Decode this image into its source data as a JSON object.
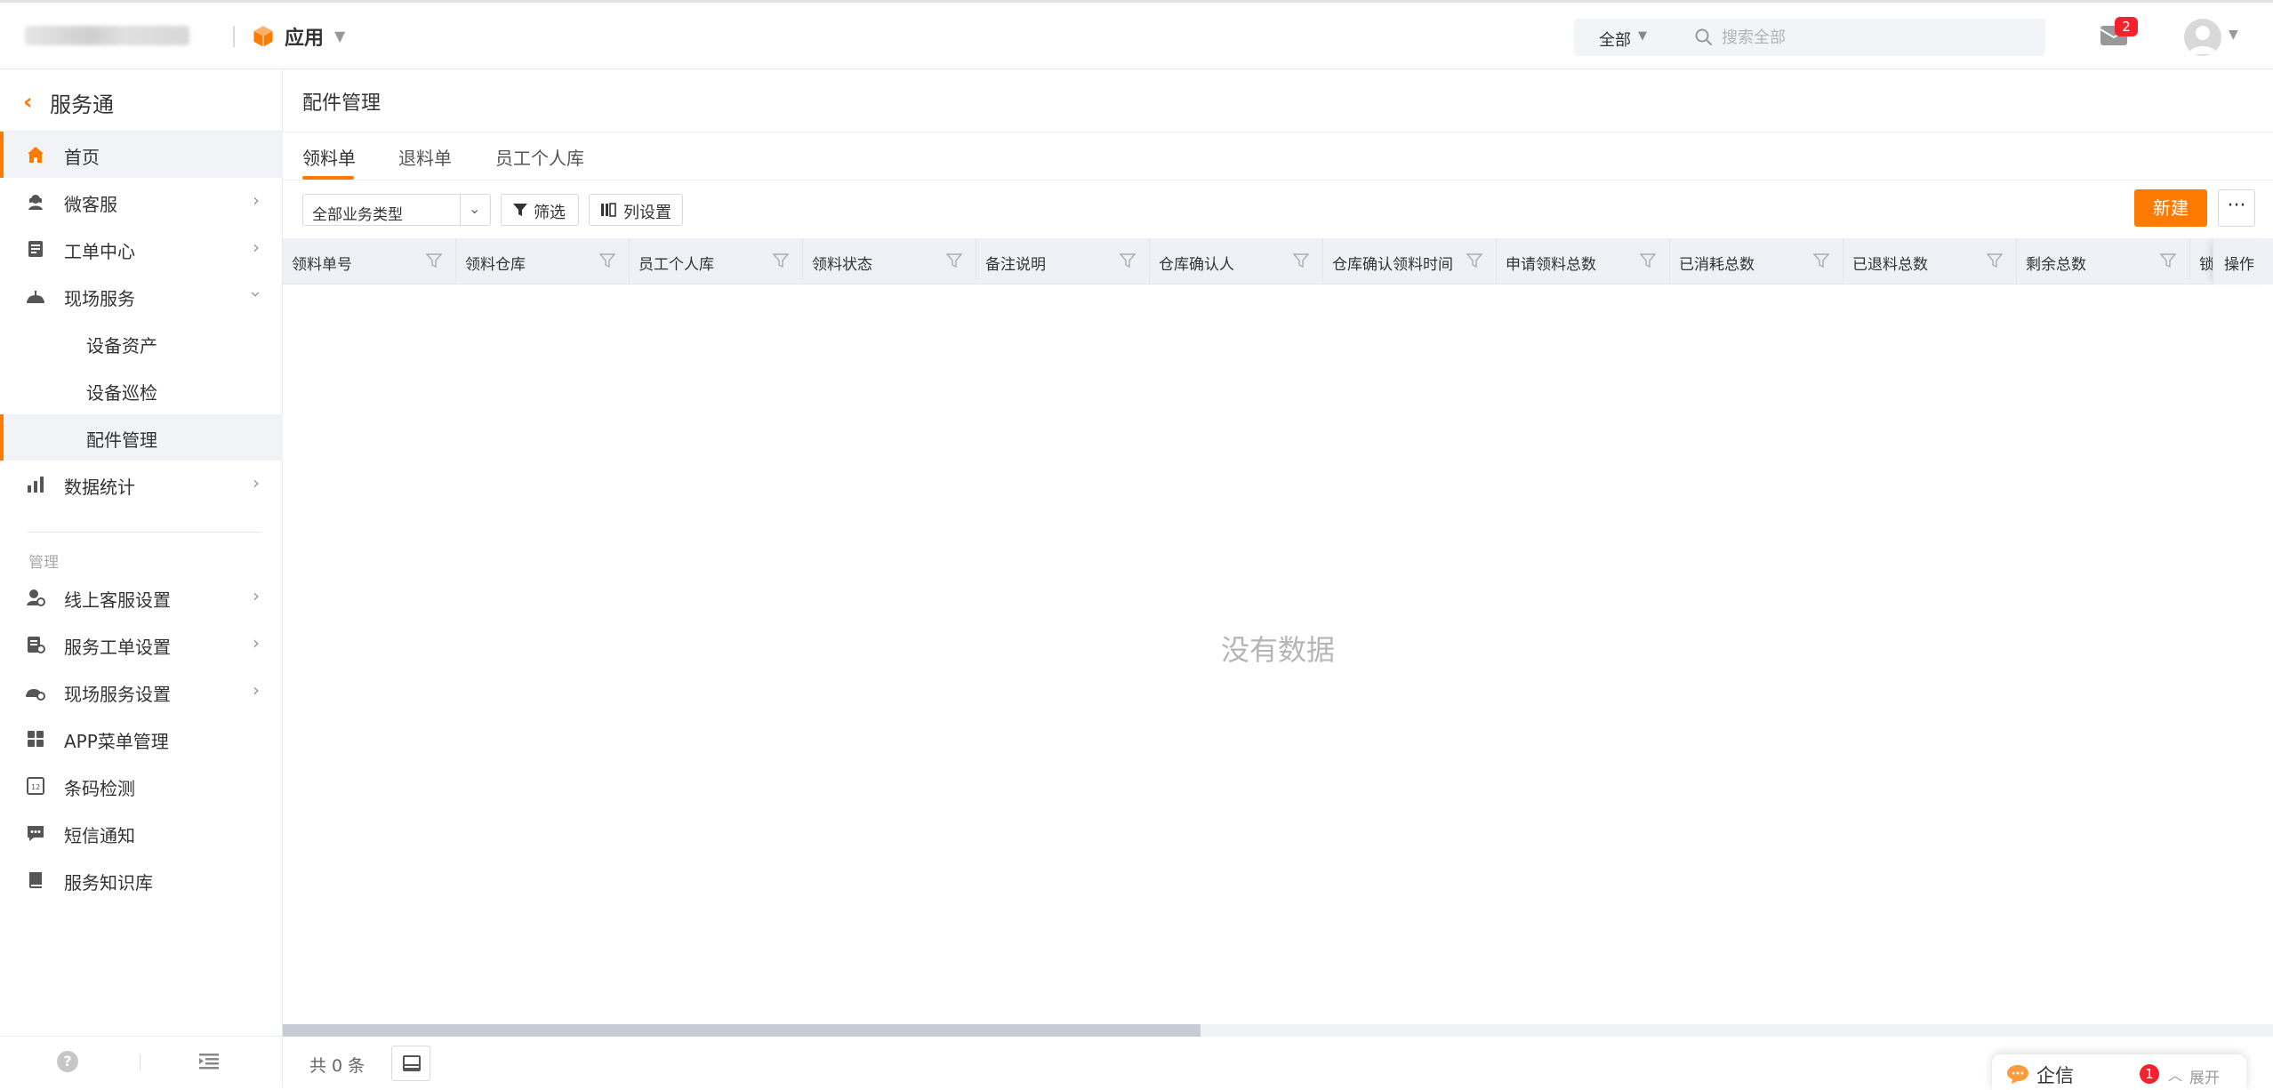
{
  "colors": {
    "accent": "#ff7a00",
    "badge": "#f5222d",
    "header_bg": "#eef1f6"
  },
  "topbar": {
    "app_label": "应用",
    "search": {
      "scope": "全部",
      "placeholder": "搜索全部"
    },
    "mail_badge": "2"
  },
  "sidebar": {
    "title": "服务通",
    "items": [
      {
        "label": "首页",
        "icon": "home-icon"
      },
      {
        "label": "微客服",
        "icon": "service-agent-icon"
      },
      {
        "label": "工单中心",
        "icon": "ticket-icon"
      },
      {
        "label": "现场服务",
        "icon": "helmet-icon"
      },
      {
        "label": "数据统计",
        "icon": "bar-chart-icon"
      }
    ],
    "sub_items": [
      "设备资产",
      "设备巡检",
      "配件管理"
    ],
    "section_label": "管理",
    "manage_items": [
      {
        "label": "线上客服设置",
        "icon": "service-settings-icon"
      },
      {
        "label": "服务工单设置",
        "icon": "ticket-settings-icon"
      },
      {
        "label": "现场服务设置",
        "icon": "field-settings-icon"
      },
      {
        "label": "APP菜单管理",
        "icon": "grid-icon"
      },
      {
        "label": "条码检测",
        "icon": "barcode-icon"
      },
      {
        "label": "短信通知",
        "icon": "sms-icon"
      },
      {
        "label": "服务知识库",
        "icon": "book-icon"
      }
    ]
  },
  "main": {
    "page_title": "配件管理",
    "tabs": [
      "领料单",
      "退料单",
      "员工个人库"
    ],
    "toolbar": {
      "type_select": "全部业务类型",
      "filter_label": "筛选",
      "columns_label": "列设置",
      "new_label": "新建",
      "more_label": "···"
    },
    "table": {
      "columns": [
        "领料单号",
        "领料仓库",
        "员工个人库",
        "领料状态",
        "备注说明",
        "仓库确认人",
        "仓库确认领料时间",
        "申请领料总数",
        "已消耗总数",
        "已退料总数",
        "剩余总数",
        "锁"
      ],
      "action_column": "操作",
      "empty_text": "没有数据"
    },
    "footer": {
      "total": "共 0 条"
    }
  },
  "chat_widget": {
    "label": "企信",
    "badge": "1",
    "expand": "展开"
  }
}
